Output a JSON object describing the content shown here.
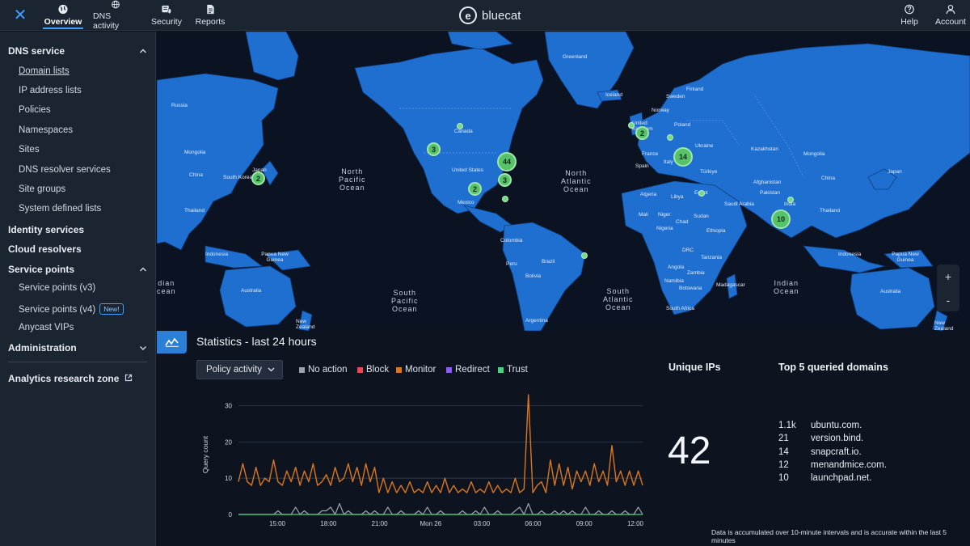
{
  "topnav": {
    "tabs": [
      {
        "label": "Overview",
        "icon": "globe-icon",
        "active": true
      },
      {
        "label": "DNS activity",
        "icon": "globe-network-icon"
      },
      {
        "label": "Security",
        "icon": "security-icon"
      },
      {
        "label": "Reports",
        "icon": "report-icon"
      }
    ],
    "brand": "bluecat",
    "brand_logo_letter": "e",
    "help_label": "Help",
    "account_label": "Account"
  },
  "sidebar": {
    "dns_service": "DNS service",
    "dns_items": [
      "Domain lists",
      "IP address lists",
      "Policies",
      "Namespaces",
      "Sites",
      "DNS resolver services",
      "Site groups",
      "System defined lists"
    ],
    "identity_services": "Identity services",
    "cloud_resolvers": "Cloud resolvers",
    "service_points": "Service points",
    "sp_items": [
      "Service points (v3)",
      "Service points (v4)",
      "Anycast VIPs"
    ],
    "new_badge": "New!",
    "administration": "Administration",
    "analytics": "Analytics research zone"
  },
  "map": {
    "country_labels": [
      "Russia",
      "Mongolia",
      "China",
      "South Korea",
      "Japan",
      "Thailand",
      "Indonesia",
      "Papua New Guinea",
      "Australia",
      "New Zealand",
      "Canada",
      "United States",
      "Mexico",
      "Greenland",
      "Iceland",
      "United Kingdom",
      "Norway",
      "Sweden",
      "Finland",
      "Poland",
      "Ukraine",
      "France",
      "Spain",
      "Italy",
      "Türkiye",
      "Kazakhstan",
      "Mongolia",
      "China",
      "Japan",
      "Afghanistan",
      "Pakistan",
      "India",
      "Thailand",
      "Indonesia",
      "Papua New Guinea",
      "Australia",
      "New Zealand",
      "Algeria",
      "Libya",
      "Egypt",
      "Saudi Arabia",
      "Mali",
      "Niger",
      "Chad",
      "Sudan",
      "Nigeria",
      "Ethiopia",
      "DRC",
      "Tanzania",
      "Angola",
      "Zambia",
      "Namibia",
      "Botswana",
      "South Africa",
      "Madagascar",
      "Colombia",
      "Peru",
      "Brazil",
      "Bolivia",
      "Argentina"
    ],
    "ocean_labels": [
      "North\nPacific\nOcean",
      "North\nAtlantic\nOcean",
      "South\nPacific\nOcean",
      "South\nAtlantic\nOcean",
      "Indian\nOcean",
      "dian\ncean"
    ],
    "clusters": [
      "2",
      "3",
      "44",
      "3",
      "2",
      "2",
      "14",
      "10"
    ],
    "zoom_in": "+",
    "zoom_out": "-"
  },
  "stats": {
    "title": "Statistics - last 24 hours",
    "policy_dropdown": "Policy activity",
    "legend": [
      {
        "label": "No action",
        "color": "#9aa3ae"
      },
      {
        "label": "Block",
        "color": "#e8475a"
      },
      {
        "label": "Monitor",
        "color": "#d9761f"
      },
      {
        "label": "Redirect",
        "color": "#8b5cf6"
      },
      {
        "label": "Trust",
        "color": "#4cd07d"
      }
    ],
    "unique_ips_title": "Unique IPs",
    "unique_ips_value": "42",
    "top5_title": "Top 5 queried domains",
    "top5": [
      {
        "count": "1.1k",
        "domain": "ubuntu.com."
      },
      {
        "count": "21",
        "domain": "version.bind."
      },
      {
        "count": "14",
        "domain": "snapcraft.io."
      },
      {
        "count": "12",
        "domain": "menandmice.com."
      },
      {
        "count": "10",
        "domain": "launchpad.net."
      }
    ],
    "footnote": "Data is accumulated over 10-minute intervals and is accurate within the last 5 minutes"
  },
  "chart_data": {
    "type": "line",
    "title": "",
    "ylabel": "Query count",
    "xlabel": "",
    "ylim": [
      0,
      33
    ],
    "yticks": [
      0,
      10,
      20,
      30
    ],
    "xticks": [
      "15:00",
      "18:00",
      "21:00",
      "Mon 26",
      "03:00",
      "06:00",
      "09:00",
      "12:00"
    ],
    "grid": true,
    "series": [
      {
        "name": "Monitor",
        "color": "#d9761f",
        "values": [
          9,
          14,
          9,
          8,
          13,
          8,
          10,
          9,
          15,
          9,
          8,
          12,
          9,
          13,
          8,
          12,
          9,
          14,
          8,
          9,
          11,
          8,
          13,
          9,
          10,
          14,
          9,
          13,
          8,
          14,
          9,
          13,
          6,
          10,
          6,
          9,
          6,
          8,
          6,
          9,
          6,
          7,
          6,
          9,
          6,
          8,
          6,
          10,
          6,
          8,
          6,
          7,
          6,
          9,
          6,
          7,
          6,
          9,
          6,
          8,
          6,
          7,
          6,
          10,
          6,
          7,
          33,
          6,
          8,
          9,
          6,
          15,
          8,
          14,
          8,
          13,
          7,
          12,
          9,
          12,
          8,
          14,
          9,
          12,
          8,
          19,
          9,
          12,
          8,
          12,
          8,
          12,
          8
        ]
      },
      {
        "name": "Trust",
        "color": "#4cd07d",
        "values": [
          0,
          0,
          0,
          0,
          0,
          0,
          0,
          0,
          0,
          0,
          0,
          0,
          0,
          0,
          0,
          0,
          0,
          0,
          0,
          0,
          0,
          0,
          0,
          0,
          0,
          0,
          0,
          0,
          0,
          0,
          0,
          0,
          0,
          0,
          0,
          0,
          0,
          0,
          0,
          0,
          0,
          0,
          0,
          0,
          0,
          0,
          0,
          0,
          0,
          0,
          0,
          0,
          0,
          0,
          0,
          0,
          0,
          0,
          0,
          0,
          0,
          0,
          0,
          0,
          0,
          0,
          0,
          0,
          0,
          0,
          0,
          0,
          0,
          0,
          0,
          0,
          0,
          0,
          0,
          0,
          0,
          0,
          0,
          0,
          0,
          0,
          0,
          0,
          0,
          0,
          0,
          0,
          0
        ]
      },
      {
        "name": "No action",
        "color": "#9aa3ae",
        "values": [
          0,
          0,
          0,
          0,
          0,
          0,
          0,
          0,
          0,
          1,
          0,
          0,
          0,
          2,
          0,
          1,
          0,
          0,
          0,
          1,
          1,
          2,
          0,
          3,
          0,
          1,
          0,
          0,
          0,
          1,
          0,
          1,
          0,
          0,
          2,
          0,
          0,
          1,
          0,
          0,
          0,
          1,
          0,
          2,
          0,
          0,
          1,
          0,
          0,
          0,
          0,
          1,
          0,
          0,
          1,
          0,
          2,
          0,
          0,
          1,
          0,
          0,
          0,
          1,
          2,
          0,
          3,
          0,
          0,
          1,
          0,
          0,
          1,
          0,
          1,
          0,
          1,
          0,
          0,
          2,
          0,
          0,
          1,
          0,
          0,
          1,
          0,
          0,
          1,
          0,
          0,
          2,
          0
        ]
      }
    ]
  }
}
